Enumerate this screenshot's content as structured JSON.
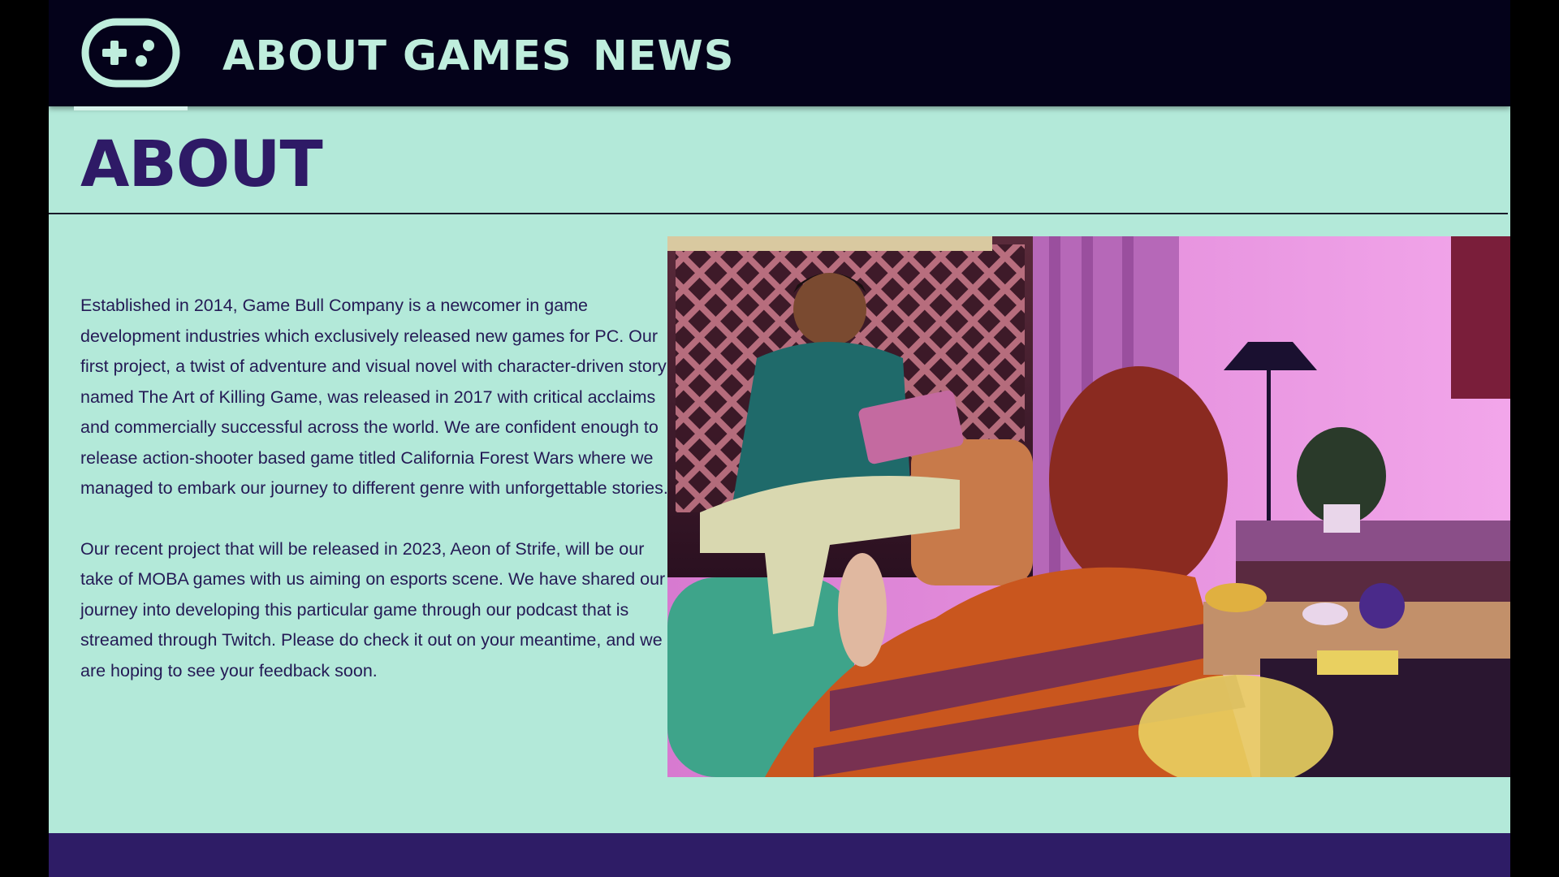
{
  "nav": {
    "logo_icon": "gamepad-icon",
    "items": [
      {
        "label": "ABOUT"
      },
      {
        "label": "GAMES"
      },
      {
        "label": "NEWS"
      }
    ]
  },
  "main": {
    "title": "ABOUT",
    "paragraphs": [
      "Established in 2014, Game Bull Company is a newcomer in game development industries which exclusively released new games for PC. Our first project, a twist of adventure and visual novel with character-driven story named The Art of Killing Game, was released in 2017 with critical acclaims and commercially successful across the world. We are confident enough to release action-shooter based game titled California Forest Wars where we managed to embark our journey to different genre with unforgettable stories.",
      "Our recent project that will be released in 2023, Aeon of Strife, will be our take of MOBA games with us aiming on esports scene. We have shared our journey into developing this particular game through our podcast that is streamed through Twitch. Please do check it out on your meantime, and we are hoping to see your feedback soon."
    ],
    "photo_icon": "people-gaming-photo"
  },
  "colors": {
    "nav_bg": "#04021a",
    "nav_text": "#bfeedd",
    "page_bg": "#b3e9d9",
    "title": "#2e1a66",
    "body_text": "#241a55",
    "footer_bg": "#2e1c66"
  }
}
